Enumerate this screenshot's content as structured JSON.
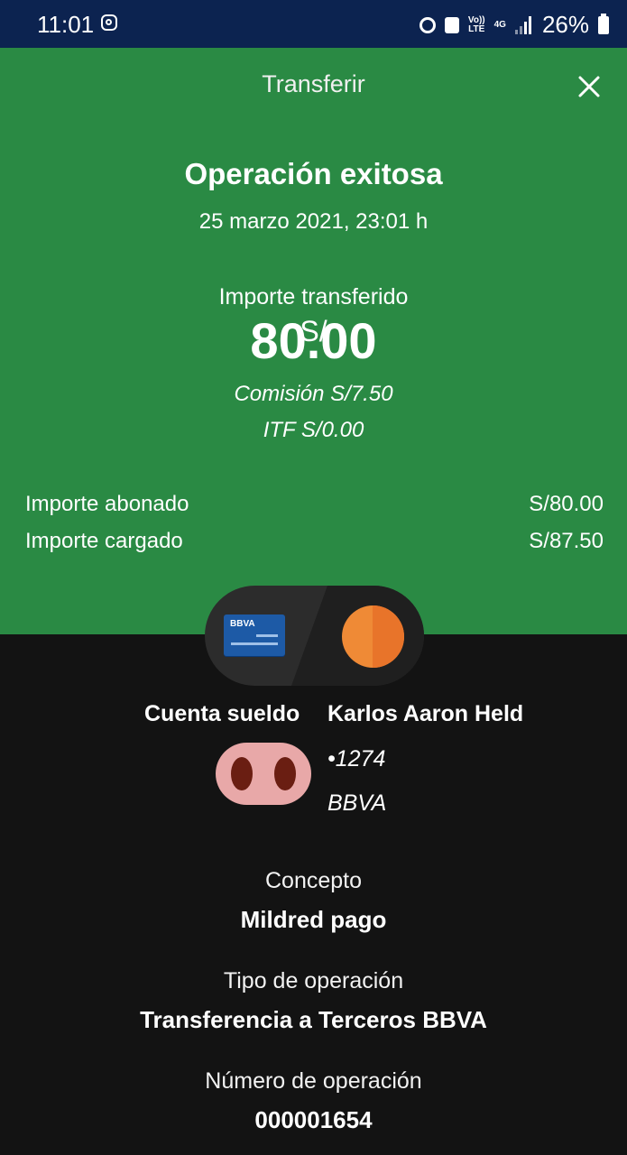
{
  "status_bar": {
    "time": "11:01",
    "volte_top": "Vo))",
    "volte_bottom": "LTE",
    "network": "4G",
    "battery": "26%"
  },
  "header": {
    "title": "Transferir"
  },
  "receipt": {
    "status_title": "Operación exitosa",
    "datetime": "25 marzo 2021, 23:01 h",
    "amount_label": "Importe transferido",
    "currency_symbol": "S/",
    "amount": "80.00",
    "fee": "Comisión  S/7.50",
    "itf": "ITF  S/0.00",
    "credited_label": "Importe abonado",
    "credited_value": "S/80.00",
    "charged_label": "Importe cargado",
    "charged_value": "S/87.50"
  },
  "accounts": {
    "card_brand": "BBVA",
    "from_name": "Cuenta sueldo",
    "to_name": "Karlos Aaron Held",
    "to_number": "•1274",
    "to_bank": "BBVA"
  },
  "details": {
    "concept_label": "Concepto",
    "concept_value": "Mildred pago",
    "type_label": "Tipo de operación",
    "type_value": "Transferencia a Terceros BBVA",
    "number_label": "Número de operación",
    "number_value": "000001654"
  },
  "colors": {
    "status_bar": "#0c2350",
    "success_green": "#2a8a44",
    "dark_background": "#131313",
    "accent_orange": "#ef8a36"
  }
}
